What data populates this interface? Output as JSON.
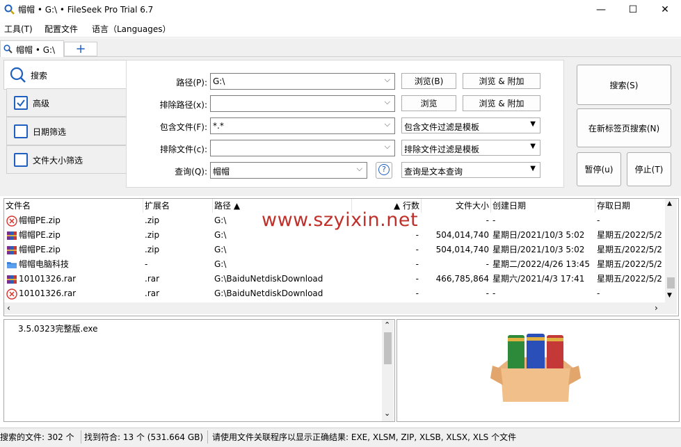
{
  "window": {
    "title": "帽帽 • G:\\ • FileSeek Pro Trial 6.7",
    "minimize": "—",
    "maximize": "☐",
    "close": "✕"
  },
  "menu": [
    "工具(T)",
    "配置文件",
    "语言（Languages）"
  ],
  "tabs": {
    "active_label": "帽帽 • G:\\",
    "add_label": "+"
  },
  "left_tabs": {
    "search": "搜索",
    "advanced": "高级",
    "date_filter": "日期筛选",
    "size_filter": "文件大小筛选"
  },
  "form": {
    "path_label": "路径(P):",
    "path_value": "G:\\",
    "exclude_path_label": "排除路径(x):",
    "exclude_path_value": "",
    "include_files_label": "包含文件(F):",
    "include_files_value": "*.*",
    "exclude_files_label": "排除文件(c):",
    "exclude_files_value": "",
    "query_label": "查询(Q):",
    "query_value": "帽帽",
    "help_glyph": "?",
    "browse": "浏览(B)",
    "browse_add": "浏览 & 附加",
    "browse2": "浏览",
    "browse_add2": "浏览 & 附加",
    "include_filter_mode": "包含文件过滤是模板",
    "exclude_filter_mode": "排除文件过滤是模板",
    "query_mode": "查询是文本查询"
  },
  "actions": {
    "search": "搜索(S)",
    "search_new_tab": "在新标签页搜索(N)",
    "pause": "暂停(u)",
    "stop": "停止(T)"
  },
  "results": {
    "columns": {
      "name": "文件名",
      "ext": "扩展名",
      "path": "路径 ▲",
      "lines": "▲ 行数",
      "size": "文件大小",
      "created": "创建日期",
      "accessed": "存取日期"
    },
    "rows": [
      {
        "icon": "error",
        "name": "帽帽PE.zip",
        "ext": ".zip",
        "path": "G:\\",
        "lines": "",
        "size": "-",
        "created": "-",
        "accessed": "-"
      },
      {
        "icon": "archive",
        "name": "帽帽PE.zip",
        "ext": ".zip",
        "path": "G:\\",
        "lines": "-",
        "size": "504,014,740",
        "created": "星期日/2021/10/3 5:02",
        "accessed": "星期五/2022/5/2"
      },
      {
        "icon": "archive",
        "name": "帽帽PE.zip",
        "ext": ".zip",
        "path": "G:\\",
        "lines": "-",
        "size": "504,014,740",
        "created": "星期日/2021/10/3 5:02",
        "accessed": "星期五/2022/5/2"
      },
      {
        "icon": "folder",
        "name": "帽帽电脑科技",
        "ext": "-",
        "path": "G:\\",
        "lines": "-",
        "size": "-",
        "created": "星期二/2022/4/26 13:45",
        "accessed": "星期五/2022/5/2"
      },
      {
        "icon": "archive",
        "name": "10101326.rar",
        "ext": ".rar",
        "path": "G:\\BaiduNetdiskDownload",
        "lines": "-",
        "size": "466,785,864",
        "created": "星期六/2021/4/3 17:41",
        "accessed": "星期五/2022/5/2"
      },
      {
        "icon": "error",
        "name": "10101326.rar",
        "ext": ".rar",
        "path": "G:\\BaiduNetdiskDownload",
        "lines": "-",
        "size": "-",
        "created": "-",
        "accessed": "-"
      }
    ]
  },
  "preview": {
    "text": "3.5.0323完整版.exe"
  },
  "watermark": "www.szyixin.net",
  "status": {
    "searched": "搜索的文件: 302 个",
    "found": "找到符合: 13 个 (531.664 GB)",
    "hint": "请使用文件关联程序以显示正确结果: EXE, XLSM, ZIP, XLSB, XLSX, XLS 个文件"
  }
}
